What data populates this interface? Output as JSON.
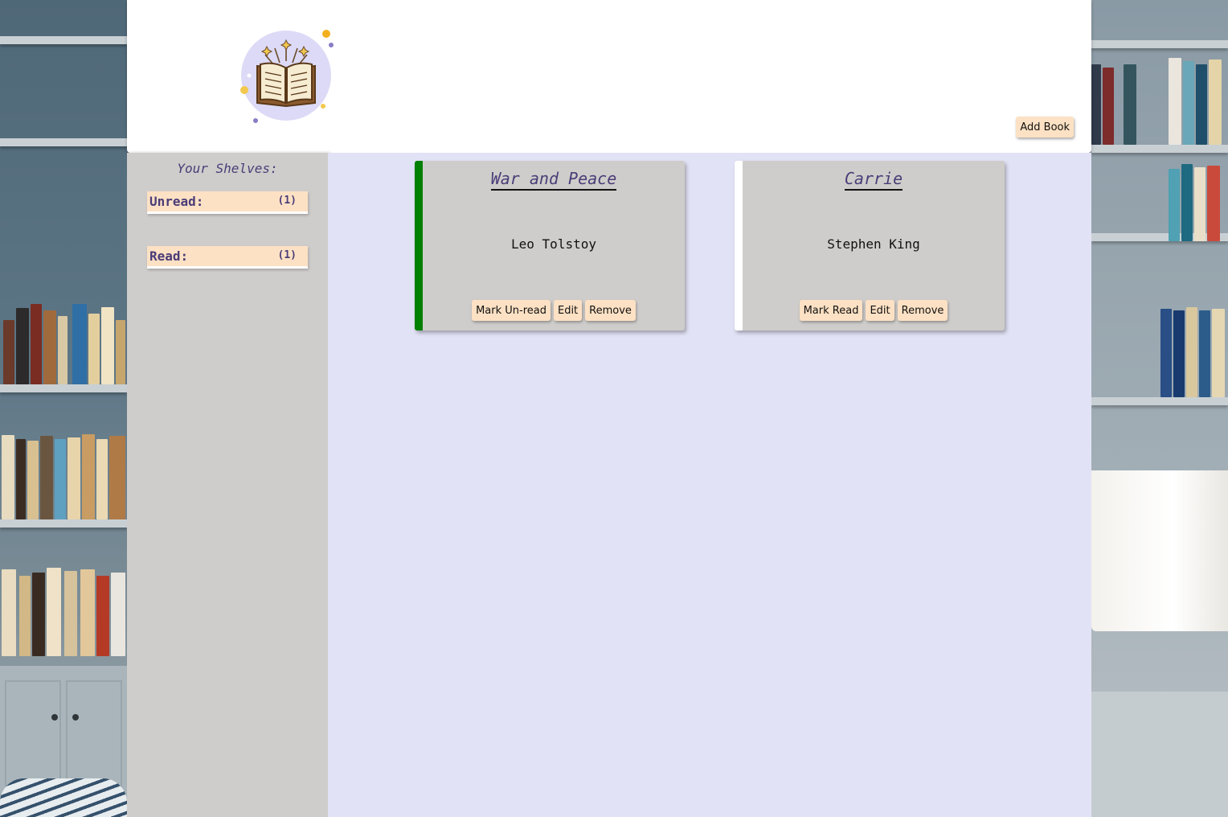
{
  "header": {
    "logo_icon": "open-book-sparkles-icon",
    "add_book_label": "Add Book"
  },
  "sidebar": {
    "title": "Your Shelves:",
    "shelves": [
      {
        "label": "Unread:",
        "count": "(1)"
      },
      {
        "label": "Read:",
        "count": "(1)"
      }
    ]
  },
  "books": [
    {
      "title": "War and Peace",
      "author": "Leo Tolstoy",
      "status_color": "#008000",
      "actions": {
        "toggle": "Mark Un-read",
        "edit": "Edit",
        "remove": "Remove"
      }
    },
    {
      "title": "Carrie",
      "author": "Stephen King",
      "status_color": "#ffffff",
      "actions": {
        "toggle": "Mark Read",
        "edit": "Edit",
        "remove": "Remove"
      }
    }
  ],
  "colors": {
    "accent_text": "#4b3d78",
    "button_bg": "#fde1c4",
    "panel_bg": "#cfcdcb",
    "main_bg": "#e2e2f6"
  }
}
